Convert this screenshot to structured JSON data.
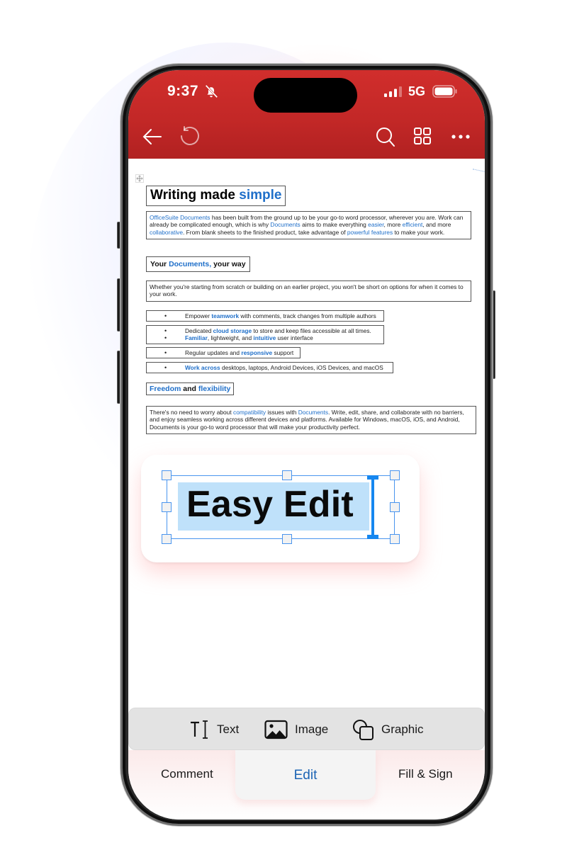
{
  "status_bar": {
    "time": "9:37",
    "network": "5G",
    "silent_icon": "bell-slash-icon",
    "signal_icon": "signal-bars-icon",
    "battery_icon": "battery-icon"
  },
  "header": {
    "icons": [
      "back-arrow-icon",
      "undo-icon",
      "search-icon",
      "grid-view-icon",
      "more-icon"
    ],
    "brand_color": "#c62a28"
  },
  "document": {
    "title": {
      "part1": "Writing made ",
      "part2": "simple"
    },
    "intro": {
      "s1": "OfficeSuite Documents",
      "s2": " has been built from the ground up to be your go-to word processor, wherever you are. Work can already be complicated enough, which is why ",
      "s3": "Documents",
      "s4": " aims to make everything ",
      "s5": "easier",
      "s6": ", more ",
      "s7": "efficient",
      "s8": ", and more ",
      "s9": "collaborative",
      "s10": ". From blank sheets to the finished product, take advantage of ",
      "s11": "powerful features",
      "s12": " to make your work."
    },
    "heading2": {
      "p1": "Your ",
      "p2": "Documents,",
      "p3": " your way"
    },
    "para2": "Whether you're starting from scratch or building on an earlier project, you won't be short on options for when it comes to your work.",
    "bullets": {
      "b1": {
        "a": "Empower ",
        "b": "teamwork",
        "c": " with comments, track changes from multiple authors"
      },
      "b2": {
        "a": "Dedicated ",
        "b": "cloud storage",
        "c": " to store and keep files accessible at all times."
      },
      "b3": {
        "a": "",
        "b": "Familiar",
        "c": ", lightweight, and ",
        "d": "intuitive",
        "e": " user interface"
      },
      "b4": {
        "a": "Regular updates and ",
        "b": "responsive",
        "c": " support"
      },
      "b5": {
        "a": "",
        "b": "Work across",
        "c": " desktops, laptops, Android Devices, iOS Devices, and macOS"
      }
    },
    "heading3": {
      "p1": "Freedom",
      "p2": " and ",
      "p3": "flexibility"
    },
    "para3": {
      "a": "There's no need to worry about ",
      "b": "compatibility",
      "c": " issues with  ",
      "d": "Documents",
      "e": ". Write, edit, share, and collaborate with no barriers, and enjoy seamless working across different devices and platforms. Available for Windows, macOS, iOS, and Android, Documents is your go-to word processor that will make your productivity perfect."
    },
    "accent_color": "#1f6fc9"
  },
  "edit_card": {
    "text": "Easy Edit",
    "selection_color": "#bfe1fa",
    "handle_color": "#4a95ee"
  },
  "insert_toolbar": {
    "items": [
      {
        "label": "Text",
        "icon": "text-cursor-icon"
      },
      {
        "label": "Image",
        "icon": "image-icon"
      },
      {
        "label": "Graphic",
        "icon": "shapes-icon"
      }
    ]
  },
  "bottom_tabs": {
    "items": [
      {
        "label": "Comment",
        "active": false
      },
      {
        "label": "Edit",
        "active": true
      },
      {
        "label": "Fill & Sign",
        "active": false
      }
    ],
    "active_color": "#1c64b4"
  }
}
